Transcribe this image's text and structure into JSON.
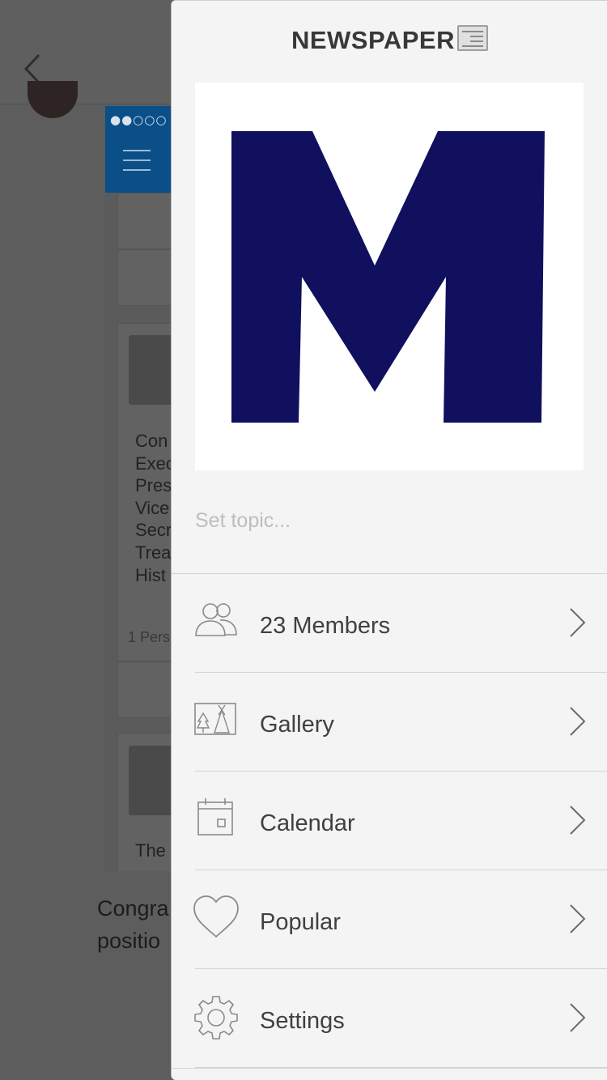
{
  "background": {
    "status_signal": "●●○○○ V",
    "post_lines": "Con\nExec\nPres\nVice\nSecr\nTrea\nHist",
    "post_reactions": "1 Pers",
    "post2_line": "The",
    "message": "Congra\npositio"
  },
  "drawer": {
    "title": "NEWSPAPER",
    "title_icon": "newspaper-emoji",
    "group_image_letter": "M",
    "group_image_color": "#10105e",
    "topic_placeholder": "Set topic...",
    "menu": [
      {
        "label": "23 Members",
        "icon": "members-icon"
      },
      {
        "label": "Gallery",
        "icon": "gallery-icon"
      },
      {
        "label": "Calendar",
        "icon": "calendar-icon"
      },
      {
        "label": "Popular",
        "icon": "heart-icon"
      },
      {
        "label": "Settings",
        "icon": "gear-icon"
      }
    ]
  }
}
